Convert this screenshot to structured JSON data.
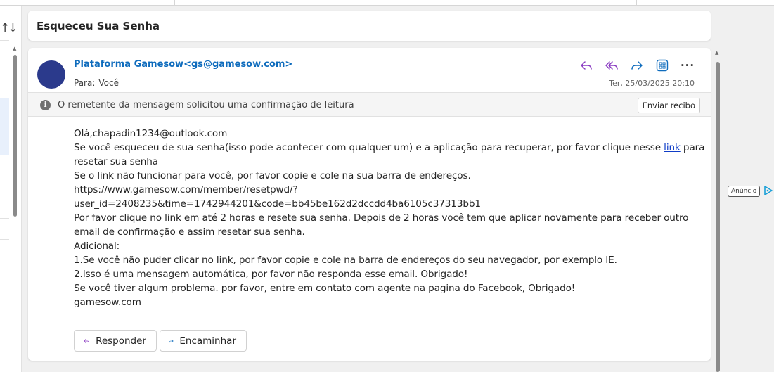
{
  "colors": {
    "accent": "#0f6cbd",
    "avatar": "#2b3a8c",
    "icon_purple": "#8a3bc2",
    "icon_blue": "#0f6cbd"
  },
  "subject": "Esqueceu Sua Senha",
  "message": {
    "sender": "Plataforma Gamesow<gs@gamesow.com>",
    "to_label": "Para:",
    "to_value": "Você",
    "date": "Ter, 25/03/2025 20:10",
    "actions": [
      {
        "name": "reply",
        "icon": "reply-icon"
      },
      {
        "name": "reply-all",
        "icon": "reply-all-icon"
      },
      {
        "name": "forward",
        "icon": "forward-icon"
      },
      {
        "name": "apps",
        "icon": "apps-icon"
      },
      {
        "name": "more",
        "icon": "more-icon",
        "label": "···"
      }
    ]
  },
  "receipt": {
    "text": "O remetente da mensagem solicitou uma confirmação de leitura",
    "button": "Enviar recibo"
  },
  "body": {
    "greeting": "Olá,chapadin1234@outlook.com",
    "p1_before": "Se você esqueceu de sua senha(isso pode acontecer com qualquer um) e a aplicação para recuperar, por favor clique nesse ",
    "p1_link": "link",
    "p1_after": " para",
    "p1_line2": "resetar sua senha",
    "p2": "Se o link não funcionar para você, por favor copie e cole na sua barra de endereços.",
    "url_line1": "https://www.gamesow.com/member/resetpwd/?",
    "url_line2": "user_id=2408235&time=1742944201&code=bb45be162d2dccdd4ba6105c37313bb1",
    "p3_line1": "Por favor clique no link em até 2 horas e resete sua senha. Depois de 2 horas você tem que aplicar novamente para receber outro",
    "p3_line2": "email de confirmação e assim resetar sua senha.",
    "additional": "Adicional:",
    "note1": "1.Se você não puder clicar no link, por favor copie e cole na barra de endereços do seu navegador, por exemplo IE.",
    "note2": "2.Isso é uma mensagem automática, por favor não responda esse email. Obrigado!",
    "note3": "Se você tiver algum problema. por favor, entre em contato com agente na pagina do Facebook, Obrigado!",
    "signature": "gamesow.com"
  },
  "reply_buttons": {
    "reply": "Responder",
    "forward": "Encaminhar"
  },
  "ad_label": "Anúncio"
}
